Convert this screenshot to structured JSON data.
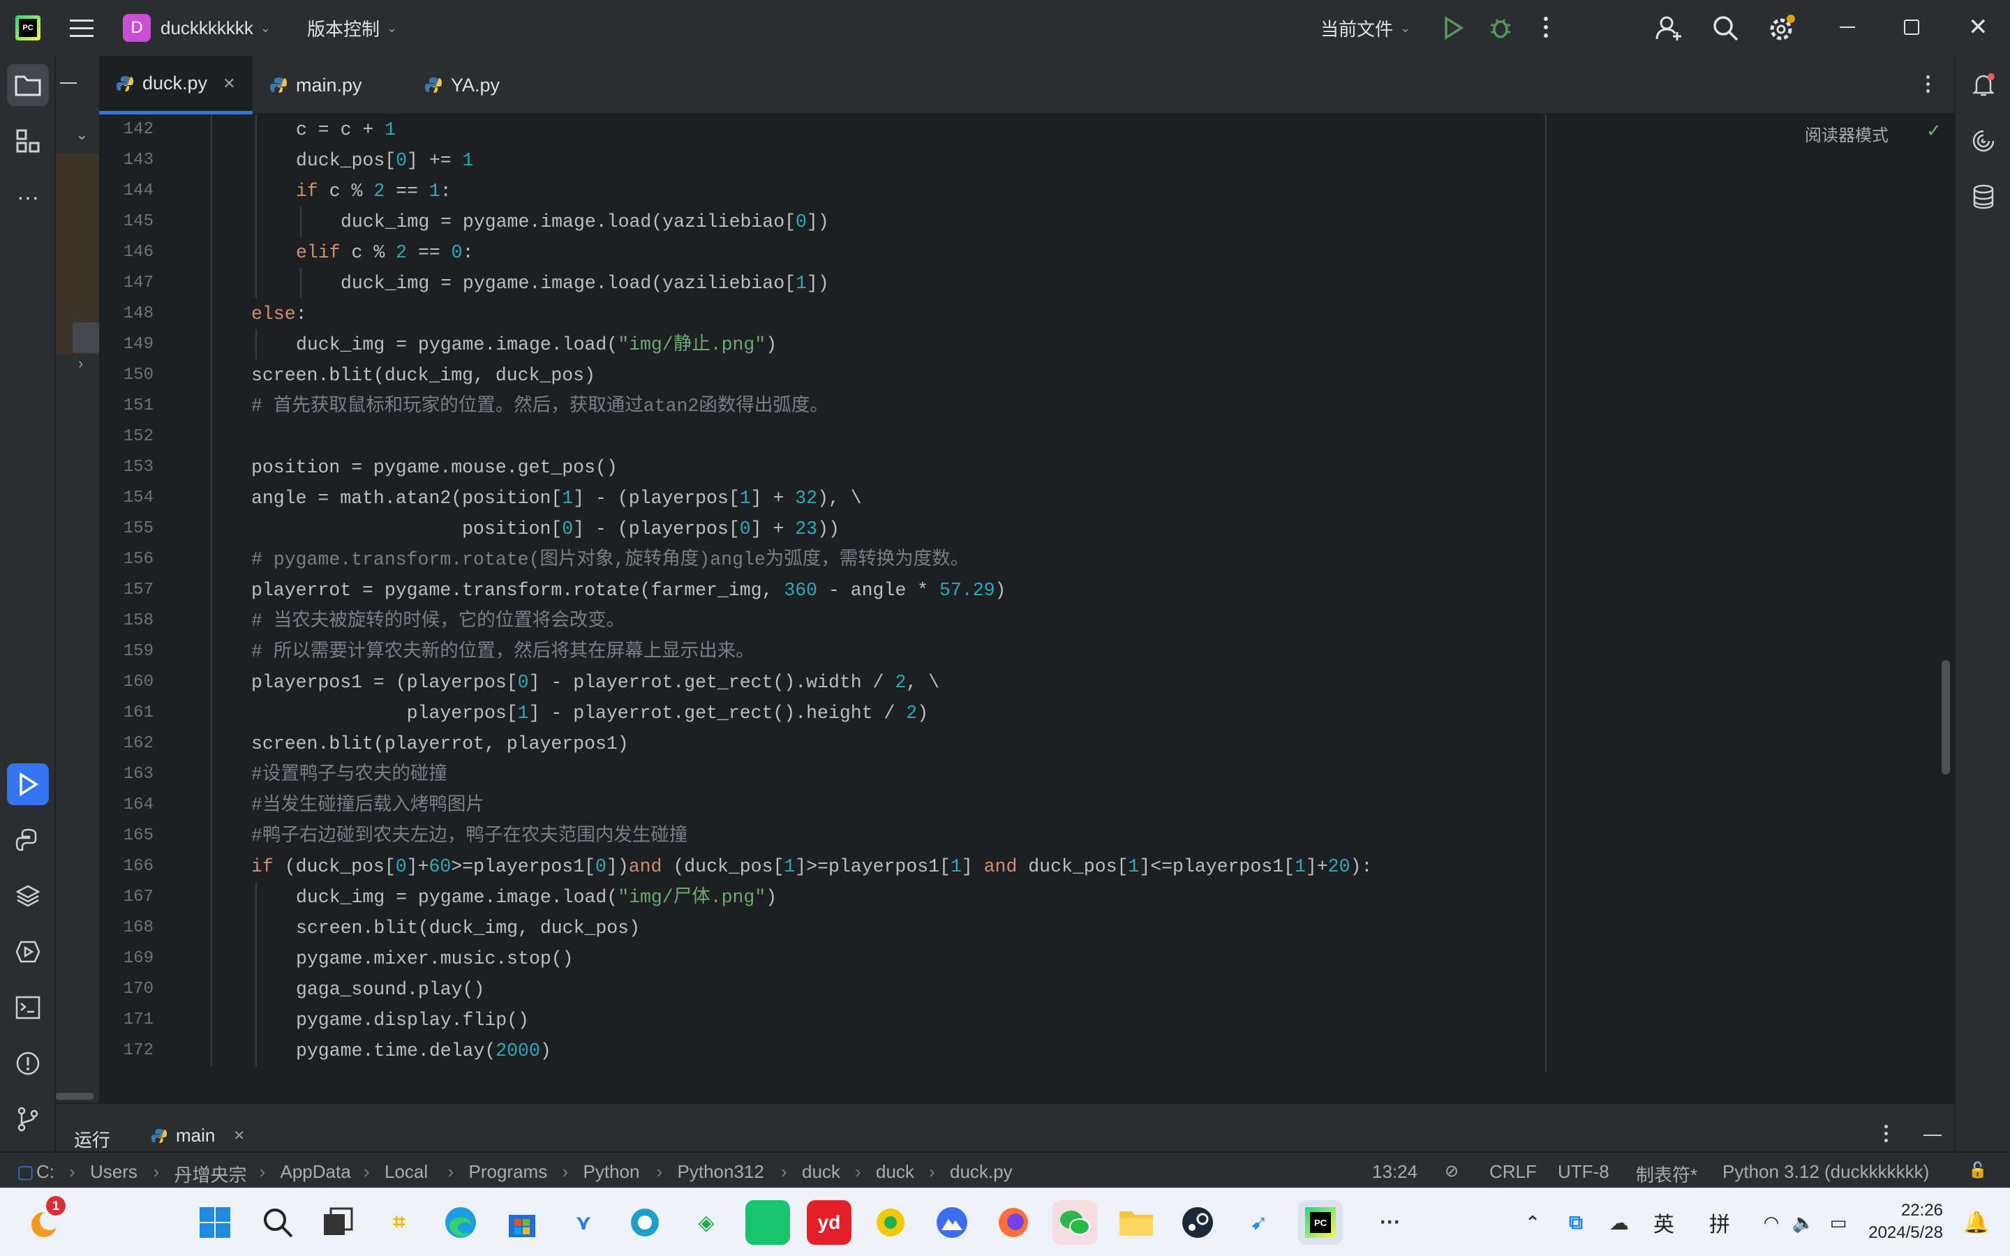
{
  "titlebar": {
    "logo": "PC",
    "project_letter": "D",
    "project_name": "duckkkkkkk",
    "vcs_label": "版本控制",
    "run_config": "当前文件"
  },
  "tabs": [
    {
      "label": "duck.py"
    },
    {
      "label": "main.py"
    },
    {
      "label": "YA.py"
    }
  ],
  "editor": {
    "reader_mode": "阅读器模式"
  },
  "code_lines": [
    {
      "n": "142",
      "indent": 2,
      "tokens": [
        [
          "c = c + ",
          ""
        ],
        [
          "1",
          "num"
        ]
      ]
    },
    {
      "n": "143",
      "indent": 2,
      "tokens": [
        [
          "duck_pos[",
          ""
        ],
        [
          "0",
          "num"
        ],
        [
          "] += ",
          ""
        ],
        [
          "1",
          "num"
        ]
      ]
    },
    {
      "n": "144",
      "indent": 2,
      "tokens": [
        [
          "if",
          "kw"
        ],
        [
          " c % ",
          ""
        ],
        [
          "2",
          "num"
        ],
        [
          " == ",
          ""
        ],
        [
          "1",
          "num"
        ],
        [
          ":",
          ""
        ]
      ]
    },
    {
      "n": "145",
      "indent": 3,
      "tokens": [
        [
          "duck_img = pygame.image.load(yaziliebiao[",
          ""
        ],
        [
          "0",
          "num"
        ],
        [
          "])",
          ""
        ]
      ]
    },
    {
      "n": "146",
      "indent": 2,
      "tokens": [
        [
          "elif",
          "kw"
        ],
        [
          " c % ",
          ""
        ],
        [
          "2",
          "num"
        ],
        [
          " == ",
          ""
        ],
        [
          "0",
          "num"
        ],
        [
          ":",
          ""
        ]
      ]
    },
    {
      "n": "147",
      "indent": 3,
      "tokens": [
        [
          "duck_img = pygame.image.load(yaziliebiao[",
          ""
        ],
        [
          "1",
          "num"
        ],
        [
          "])",
          ""
        ]
      ]
    },
    {
      "n": "148",
      "indent": 1,
      "tokens": [
        [
          "else",
          "kw"
        ],
        [
          ":",
          ""
        ]
      ]
    },
    {
      "n": "149",
      "indent": 2,
      "tokens": [
        [
          "duck_img = pygame.image.load(",
          ""
        ],
        [
          "\"img/静止.png\"",
          "str"
        ],
        [
          ")",
          ""
        ]
      ]
    },
    {
      "n": "150",
      "indent": 1,
      "tokens": [
        [
          "screen.blit(duck_img, duck_pos)",
          ""
        ]
      ]
    },
    {
      "n": "151",
      "indent": 1,
      "tokens": [
        [
          "# 首先获取鼠标和玩家的位置。然后，获取通过atan2函数得出弧度。",
          "cm"
        ]
      ]
    },
    {
      "n": "152",
      "indent": 0,
      "tokens": []
    },
    {
      "n": "153",
      "indent": 1,
      "tokens": [
        [
          "position = pygame.mouse.get_pos()",
          ""
        ]
      ]
    },
    {
      "n": "154",
      "indent": 1,
      "tokens": [
        [
          "angle = math.atan2(position[",
          ""
        ],
        [
          "1",
          "num"
        ],
        [
          "] - (playerpos[",
          ""
        ],
        [
          "1",
          "num"
        ],
        [
          "] + ",
          ""
        ],
        [
          "32",
          "num"
        ],
        [
          "), \\",
          ""
        ]
      ]
    },
    {
      "n": "155",
      "indent": 1,
      "tokens": [
        [
          "                   position[",
          ""
        ],
        [
          "0",
          "num"
        ],
        [
          "] - (playerpos[",
          ""
        ],
        [
          "0",
          "num"
        ],
        [
          "] + ",
          ""
        ],
        [
          "23",
          "num"
        ],
        [
          "))",
          ""
        ]
      ]
    },
    {
      "n": "156",
      "indent": 1,
      "tokens": [
        [
          "# pygame.transform.rotate(图片对象,旋转角度)angle为弧度，需转换为度数。",
          "cm"
        ]
      ]
    },
    {
      "n": "157",
      "indent": 1,
      "tokens": [
        [
          "playerrot = pygame.transform.rotate(farmer_img, ",
          ""
        ],
        [
          "360",
          "num"
        ],
        [
          " - angle * ",
          ""
        ],
        [
          "57.29",
          "num"
        ],
        [
          ")",
          ""
        ]
      ]
    },
    {
      "n": "158",
      "indent": 1,
      "tokens": [
        [
          "# 当农夫被旋转的时候，它的位置将会改变。",
          "cm"
        ]
      ]
    },
    {
      "n": "159",
      "indent": 1,
      "tokens": [
        [
          "# 所以需要计算农夫新的位置，然后将其在屏幕上显示出来。",
          "cm"
        ]
      ]
    },
    {
      "n": "160",
      "indent": 1,
      "tokens": [
        [
          "playerpos1 = (playerpos[",
          ""
        ],
        [
          "0",
          "num"
        ],
        [
          "] - playerrot.get_rect().width / ",
          ""
        ],
        [
          "2",
          "num"
        ],
        [
          ", \\",
          ""
        ]
      ]
    },
    {
      "n": "161",
      "indent": 1,
      "tokens": [
        [
          "              playerpos[",
          ""
        ],
        [
          "1",
          "num"
        ],
        [
          "] - playerrot.get_rect().height / ",
          ""
        ],
        [
          "2",
          "num"
        ],
        [
          ")",
          ""
        ]
      ]
    },
    {
      "n": "162",
      "indent": 1,
      "tokens": [
        [
          "screen.blit(playerrot, playerpos1)",
          ""
        ]
      ]
    },
    {
      "n": "163",
      "indent": 1,
      "tokens": [
        [
          "#设置鸭子与农夫的碰撞",
          "cm"
        ]
      ]
    },
    {
      "n": "164",
      "indent": 1,
      "tokens": [
        [
          "#当发生碰撞后载入烤鸭图片",
          "cm"
        ]
      ]
    },
    {
      "n": "165",
      "indent": 1,
      "tokens": [
        [
          "#鸭子右边碰到农夫左边，鸭子在农夫范围内发生碰撞",
          "cm"
        ]
      ]
    },
    {
      "n": "166",
      "indent": 1,
      "tokens": [
        [
          "if",
          "kw"
        ],
        [
          " (duck_pos[",
          ""
        ],
        [
          "0",
          "num"
        ],
        [
          "]+",
          ""
        ],
        [
          "60",
          "num"
        ],
        [
          ">=playerpos1[",
          ""
        ],
        [
          "0",
          "num"
        ],
        [
          "])",
          ""
        ],
        [
          "and",
          "kw"
        ],
        [
          " (duck_pos[",
          ""
        ],
        [
          "1",
          "num"
        ],
        [
          "]>=playerpos1[",
          ""
        ],
        [
          "1",
          "num"
        ],
        [
          "] ",
          ""
        ],
        [
          "and",
          "kw"
        ],
        [
          " duck_pos[",
          ""
        ],
        [
          "1",
          "num"
        ],
        [
          "]<=playerpos1[",
          ""
        ],
        [
          "1",
          "num"
        ],
        [
          "]+",
          ""
        ],
        [
          "20",
          "num"
        ],
        [
          "):",
          ""
        ]
      ]
    },
    {
      "n": "167",
      "indent": 2,
      "tokens": [
        [
          "duck_img = pygame.image.load(",
          ""
        ],
        [
          "\"img/尸体.png\"",
          "str"
        ],
        [
          ")",
          ""
        ]
      ]
    },
    {
      "n": "168",
      "indent": 2,
      "tokens": [
        [
          "screen.blit(duck_img, duck_pos)",
          ""
        ]
      ]
    },
    {
      "n": "169",
      "indent": 2,
      "tokens": [
        [
          "pygame.mixer.music.stop()",
          ""
        ]
      ]
    },
    {
      "n": "170",
      "indent": 2,
      "tokens": [
        [
          "gaga_sound.play()",
          ""
        ]
      ]
    },
    {
      "n": "171",
      "indent": 2,
      "tokens": [
        [
          "pygame.display.flip()",
          ""
        ]
      ]
    },
    {
      "n": "172",
      "indent": 2,
      "tokens": [
        [
          "pygame.time.delay(",
          ""
        ],
        [
          "2000",
          "num"
        ],
        [
          ")",
          ""
        ]
      ]
    }
  ],
  "bottom_panel": {
    "run_label": "运行",
    "tab_label": "main"
  },
  "breadcrumb": [
    "C:",
    "Users",
    "丹增央宗",
    "AppData",
    "Local",
    "Programs",
    "Python",
    "Python312",
    "duck",
    "duck",
    "duck.py"
  ],
  "status": {
    "position": "13:24",
    "line_sep": "CRLF",
    "encoding": "UTF-8",
    "indent": "制表符*",
    "interpreter": "Python 3.12 (duckkkkkkk)"
  },
  "taskbar": {
    "time": "22:26",
    "date": "2024/5/28",
    "ime1": "英",
    "ime2": "拼",
    "badge": "1"
  }
}
